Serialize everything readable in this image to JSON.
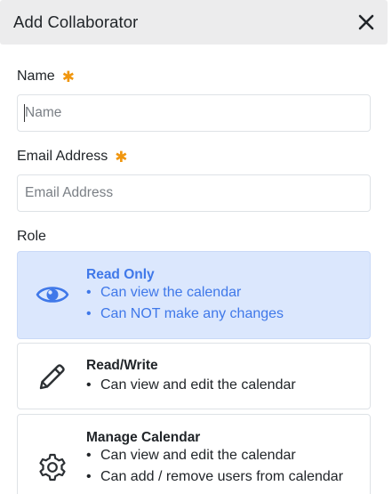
{
  "dialog": {
    "title": "Add Collaborator",
    "close_icon": "close-x-icon"
  },
  "form": {
    "name": {
      "label": "Name",
      "required_mark": "✱",
      "placeholder": "Name",
      "value": ""
    },
    "email": {
      "label": "Email Address",
      "required_mark": "✱",
      "placeholder": "Email Address",
      "value": ""
    },
    "role": {
      "label": "Role",
      "selected": "Read Only",
      "options": [
        {
          "title": "Read Only",
          "icon": "eye-icon",
          "bullets": [
            "Can view the calendar",
            "Can NOT make any changes"
          ]
        },
        {
          "title": "Read/Write",
          "icon": "pencil-icon",
          "bullets": [
            "Can view and edit the calendar"
          ]
        },
        {
          "title": "Manage Calendar",
          "icon": "gear-icon",
          "bullets": [
            "Can view and edit the calendar",
            "Can add / remove users from calendar"
          ]
        }
      ]
    }
  },
  "colors": {
    "required": "#f0960e",
    "selected_bg": "#dbe7fd",
    "selected_text": "#3f78e9",
    "header_bg": "#ececed"
  }
}
